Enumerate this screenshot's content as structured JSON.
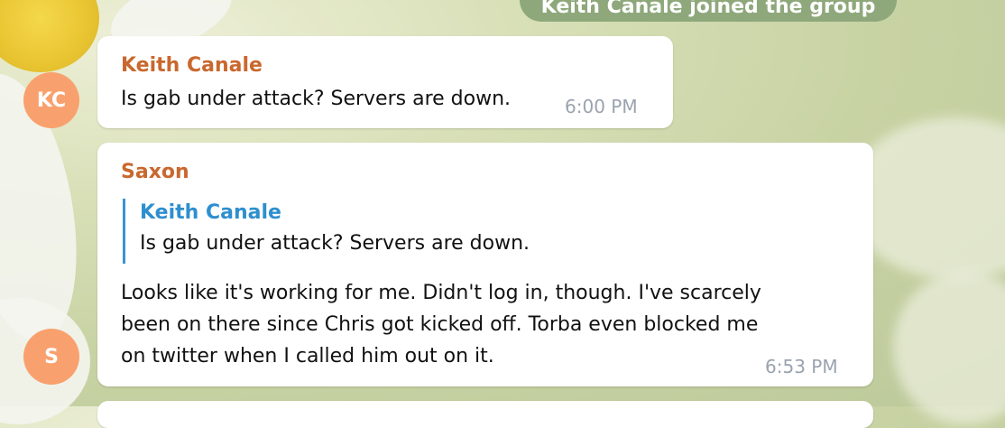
{
  "service_message": "Keith Canale joined the group",
  "messages": [
    {
      "sender": "Keith Canale",
      "avatar_initials": "KC",
      "text": "Is gab under attack? Servers are down.",
      "time": "6:00 PM"
    },
    {
      "sender": "Saxon",
      "avatar_initials": "S",
      "reply": {
        "sender": "Keith Canale",
        "text": "Is gab under attack? Servers are down."
      },
      "lines": [
        "Looks like it's working for me. Didn't log in, though. I've scarcely",
        "been on there since Chris got kicked off. Torba even blocked me",
        "on twitter when I called him out on it."
      ],
      "time": "6:53 PM"
    }
  ],
  "colors": {
    "sender_name": "#c9682e",
    "reply_name": "#2e8fcf",
    "avatar": "#f9a16e",
    "service_pill": "#8ea87b"
  }
}
